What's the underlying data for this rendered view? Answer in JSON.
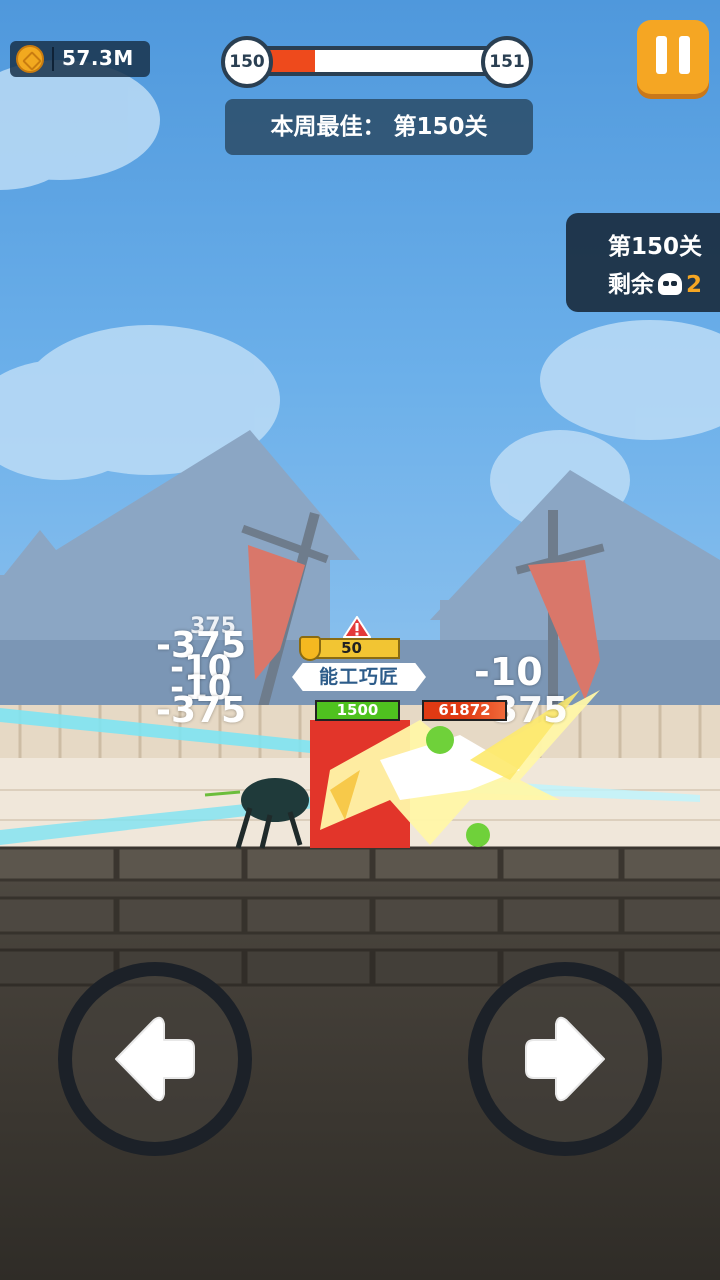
{
  "hud": {
    "coins": "57.3M",
    "coin_icon": "coin-icon",
    "level_current": "150",
    "level_next": "151",
    "level_progress_fraction": 0.28,
    "weekly_best": "本周最佳： 第150关",
    "pause_icon": "pause-icon"
  },
  "stage_panel": {
    "stage_label": "第150关",
    "remaining_label": "剩余",
    "remaining_count": "2",
    "skull_icon": "skull-icon"
  },
  "battle": {
    "boss_shield_value": "50",
    "boss_title": "能工巧匠",
    "player_hp": "1500",
    "boss_hp": "61872",
    "damage_numbers_left": [
      "375",
      "-375",
      "-10",
      "-10",
      "-375"
    ],
    "damage_numbers_right": [
      "-10",
      "-375"
    ]
  },
  "controls": {
    "left_icon": "arrow-left-icon",
    "right_icon": "arrow-right-icon"
  },
  "colors": {
    "pause_button": "#f5a623",
    "progress_fill": "#ee4a1c",
    "player_hp": "#4fc21f",
    "boss_hp": "#e03a13",
    "accent_count": "#f5a623"
  }
}
